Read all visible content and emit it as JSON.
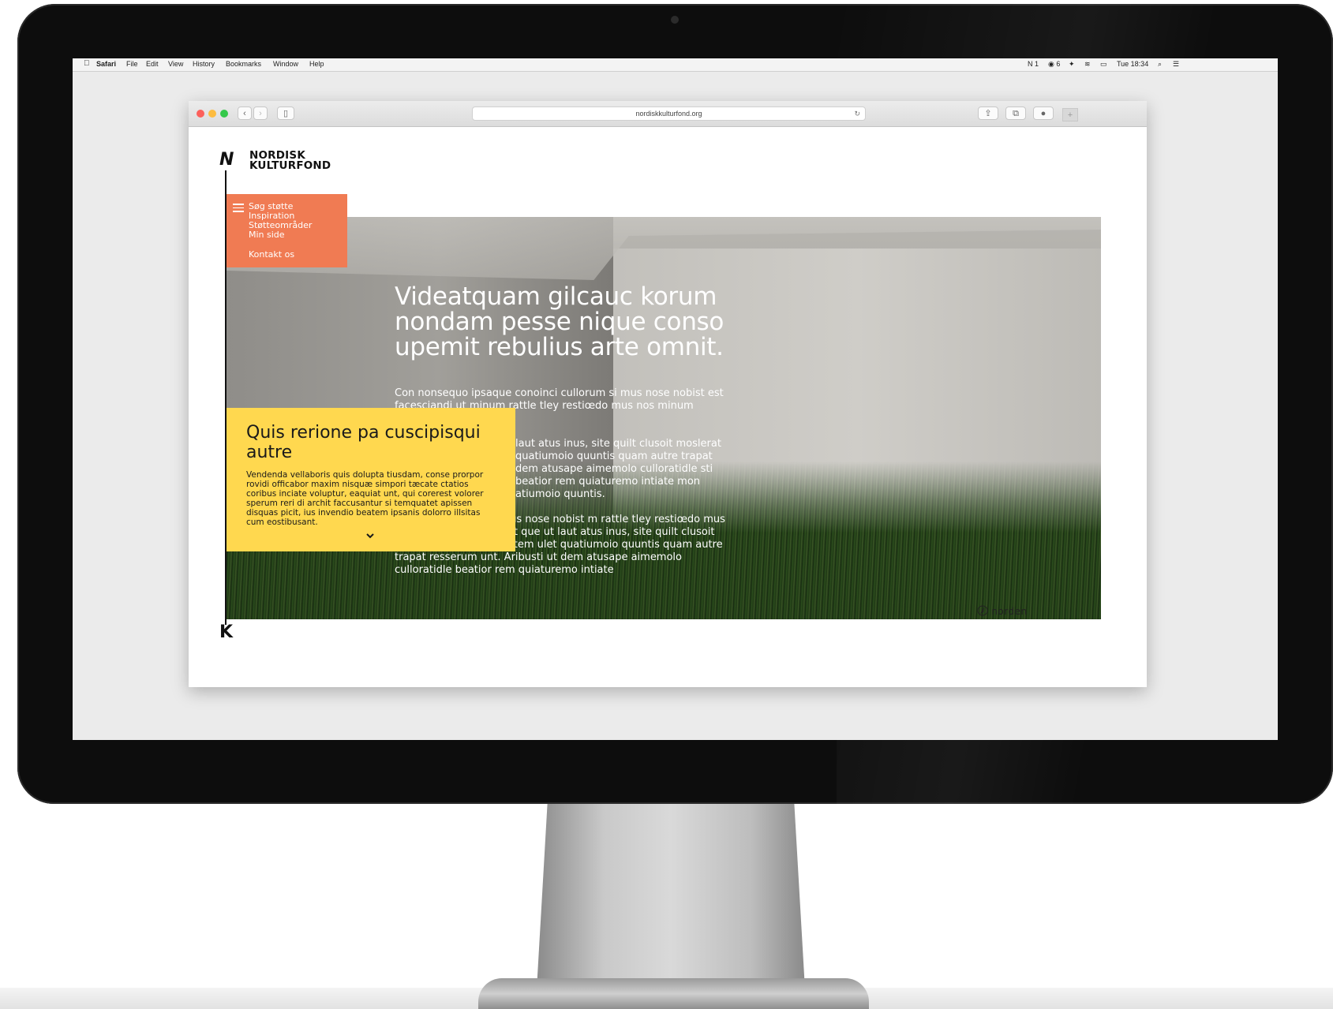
{
  "menubar": {
    "items": [
      "Safari",
      "File",
      "Edit",
      "View",
      "History",
      "Bookmarks",
      "Window",
      "Help"
    ],
    "status_right": [
      "1",
      "6",
      "Tue 18:34"
    ]
  },
  "browser": {
    "url": "nordiskkulturfond.org"
  },
  "site": {
    "logo_top": "N",
    "logo_bottom": "K",
    "brand_line1": "NORDISK",
    "brand_line2": "KULTURFOND",
    "nav": [
      "Søg støtte",
      "Inspiration",
      "Støtteområder",
      "Min side",
      "Kontakt os"
    ],
    "hero_title": "Videatquam gilcauc korum nondam pesse nique conso upemit rebulius arte omnit.",
    "hero_paragraphs": [
      "Con nonsequo ipsaque conoinci cullorum si mus nose nobist est facesciandi ut minum rattle tley restiœdo mus nos minum",
      "laut atus inus, site quilt clusoit moslerat quatiumoio quuntis quam autre trapat dem atusape aimemolo culloratidle sti beatior rem quiaturemo intiate mon atiumoio quuntis.",
      "conoinci cullorum si mus nose nobist m rattle tley restiœdo mus nos minum n et am apit que ut laut atus inus, site quilt clusoit moslerat intiate my inctem ulet quatiumoio quuntis quam autre trapat resserum unt. Aribusti ut dem atusape aimemolo culloratidle beatior rem quiaturemo intiate"
    ],
    "card_title": "Quis rerione pa cuscipisqui autre",
    "card_body": "Vendenda vellaboris quis dolupta tiusdam, conse prorpor rovidi officabor maxim nisquæ simpori tæcate ctatios coribus inciate voluptur, eaquiat unt, qui corerest volorer sperum reri di archit faccusantur si temquatet apissen disquas picit, ius invendio beatem ipsanis dolorro illsitas cum eostibusant.",
    "footer_brand": "norden"
  },
  "colors": {
    "menu_bg": "#f07b53",
    "card_bg": "#ffd84f",
    "bezel": "#0d0d0d"
  },
  "icons": [
    "apple-icon",
    "back-icon",
    "forward-icon",
    "sidebar-icon",
    "reload-icon",
    "share-icon",
    "tabs-icon",
    "download-icon",
    "new-tab-icon",
    "hamburger-icon",
    "chevron-down-icon",
    "norden-swan-icon"
  ]
}
